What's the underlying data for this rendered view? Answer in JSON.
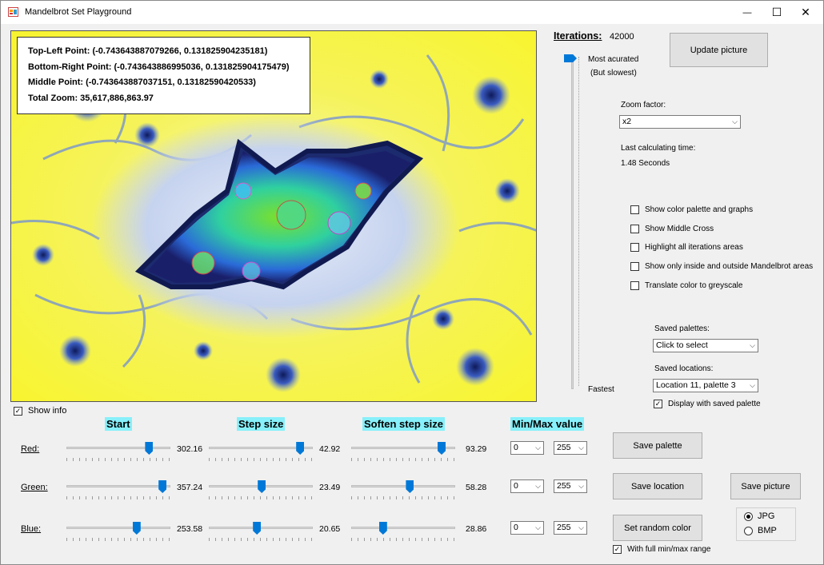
{
  "window": {
    "title": "Mandelbrot Set Playground",
    "minimize": "—",
    "maximize": "☐",
    "close": "✕"
  },
  "info": {
    "top_left": "Top-Left  Point:  (-0.743643887079266,  0.131825904235181)",
    "bottom_right": "Bottom-Right  Point:  (-0.743643886995036,  0.131825904175479)",
    "middle": "Middle  Point:  (-0.743643887037151,  0.13182590420533)",
    "zoom": "Total Zoom: 35,617,886,863.97"
  },
  "show_info": {
    "label": "Show info",
    "checked": true
  },
  "iterations": {
    "label": "Iterations:",
    "value": "42000",
    "most_accurate": "Most acurated",
    "but_slowest": "(But slowest)",
    "fastest": "Fastest",
    "slider_level": 1.0
  },
  "update_button": "Update picture",
  "zoom_factor": {
    "label": "Zoom factor:",
    "selected": "x2"
  },
  "calc_time": {
    "label": "Last calculating time:",
    "value": "1.48 Seconds"
  },
  "options": [
    {
      "label": "Show color palette and graphs",
      "checked": false
    },
    {
      "label": "Show Middle Cross",
      "checked": false
    },
    {
      "label": "Highlight all iterations areas",
      "checked": false
    },
    {
      "label": "Show only inside and outside Mandelbrot areas",
      "checked": false
    },
    {
      "label": "Translate color to greyscale",
      "checked": false
    }
  ],
  "saved_palettes": {
    "label": "Saved palettes:",
    "selected": "Click to select"
  },
  "saved_locations": {
    "label": "Saved locations:",
    "selected": "Location 11, palette 3"
  },
  "display_saved_palette": {
    "label": "Display with saved palette",
    "checked": true
  },
  "headings": {
    "start": "Start",
    "step": "Step size",
    "soften": "Soften step size",
    "minmax": "Min/Max value"
  },
  "channels": [
    {
      "label": "Red:",
      "start": "302.16",
      "step": "42.92",
      "soften": "93.29",
      "min": "0",
      "max": "255",
      "start_level": 0.82,
      "step_level": 0.91,
      "soften_level": 0.9
    },
    {
      "label": "Green:",
      "start": "357.24",
      "step": "23.49",
      "soften": "58.28",
      "min": "0",
      "max": "255",
      "start_level": 0.96,
      "step_level": 0.51,
      "soften_level": 0.57
    },
    {
      "label": "Blue:",
      "start": "253.58",
      "step": "20.65",
      "soften": "28.86",
      "min": "0",
      "max": "255",
      "start_level": 0.69,
      "step_level": 0.46,
      "soften_level": 0.29
    }
  ],
  "buttons": {
    "save_palette": "Save  palette",
    "save_location": "Save location",
    "save_picture": "Save picture",
    "random_color": "Set random color"
  },
  "full_range": {
    "label": "With full min/max range",
    "checked": true
  },
  "format": {
    "jpg": "JPG",
    "bmp": "BMP",
    "selected": "JPG"
  },
  "colors": {
    "accent": "#0078d7",
    "heading_bg": "#87f0fa",
    "fractal_bg": "#f7f43a"
  }
}
